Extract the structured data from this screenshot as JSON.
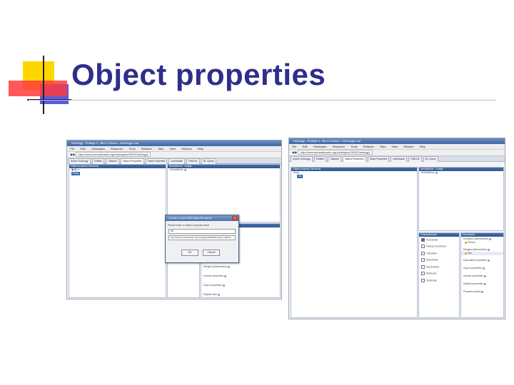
{
  "slide": {
    "title": "Object properties",
    "colors": {
      "title": "#2e2e8c",
      "deco_yellow": "#ffd700",
      "deco_red": "#ff3b3b",
      "deco_blue": "#5a5ae8"
    }
  },
  "shot_left": {
    "window_title": "Ontology - Protégé 4 - file:/C:/Users/.../Ontology1.owl",
    "menu": [
      "File",
      "Edit",
      "Ontologies",
      "Reasoner",
      "Tools",
      "Refactor",
      "Tabs",
      "View",
      "Window",
      "Help"
    ],
    "address": "http://www.semanticweb.org/ontologies/2009/Ontology1",
    "tabs": [
      "Active Ontology",
      "Entities",
      "Classes",
      "Object Properties",
      "Data Properties",
      "Individuals",
      "OWLViz",
      "DL Query"
    ],
    "active_tab": 3,
    "hierarchy_header": "Object property hierarchy",
    "tree_root": "thing",
    "annotations_header": "Annotations",
    "annotations_item": "Annotations",
    "usage_header": "Usage",
    "characteristics_header": "Characteristics",
    "characteristics_item": "Functional",
    "description_items": [
      "Domains (intersection)",
      "Ranges (intersection)",
      "Inverse properties",
      "Super properties",
      "Disjoint with"
    ],
    "dialog": {
      "title": "Create a new OWLObjectProperty",
      "name_label": "Please enter an object property name",
      "name_value": "rel",
      "uri_value": "http://www.semanticweb.org/ontologies/2009/Ontology1.owl#rel",
      "ok": "OK",
      "cancel": "Cancel"
    }
  },
  "shot_right": {
    "window_title": "Ontology - Protégé 4 - file:/C:/Users/.../Ontology1.owl",
    "menu": [
      "File",
      "Edit",
      "Ontologies",
      "Reasoner",
      "Tools",
      "Refactor",
      "Tabs",
      "View",
      "Window",
      "Help"
    ],
    "address": "http://www.semanticweb.org/ontologies/2009/Ontology1",
    "tabs": [
      "Active Ontology",
      "Entities",
      "Classes",
      "Object Properties",
      "Data Properties",
      "Individuals",
      "OWLViz",
      "DL Query"
    ],
    "active_tab": 3,
    "hierarchy_header": "Object property hierarchy",
    "tree_root": "thing",
    "tree_child": "rel",
    "annotations_header": "Annotations",
    "usage_header": "Usage",
    "annotations_item": "Annotations",
    "characteristics_header": "Characteristics",
    "characteristics": [
      {
        "label": "Functional",
        "checked": true
      },
      {
        "label": "Inverse functional",
        "checked": false
      },
      {
        "label": "Transitive",
        "checked": false
      },
      {
        "label": "Symmetric",
        "checked": false
      },
      {
        "label": "Asymmetric",
        "checked": false
      },
      {
        "label": "Reflexive",
        "checked": false
      },
      {
        "label": "Irreflexive",
        "checked": false
      }
    ],
    "description_header": "Description",
    "description_items": [
      "Domains (intersection)",
      "Ranges (intersection)",
      "Equivalent properties",
      "Super properties",
      "Inverse properties",
      "Disjoint properties",
      "Property chains"
    ],
    "domain_value": "Person",
    "range_value": "Car"
  }
}
